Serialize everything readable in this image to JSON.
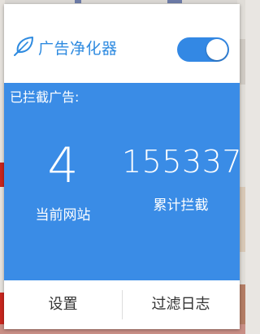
{
  "app": {
    "title": "广告净化器",
    "toggle_on": true,
    "accent_color": "#3a8ce6",
    "icon": "leaf-icon"
  },
  "stats": {
    "heading": "已拦截广告:",
    "current_site": {
      "value": "4",
      "label": "当前网站"
    },
    "total": {
      "value": "155337",
      "label": "累计拦截"
    }
  },
  "footer": {
    "settings_label": "设置",
    "log_label": "过滤日志"
  }
}
